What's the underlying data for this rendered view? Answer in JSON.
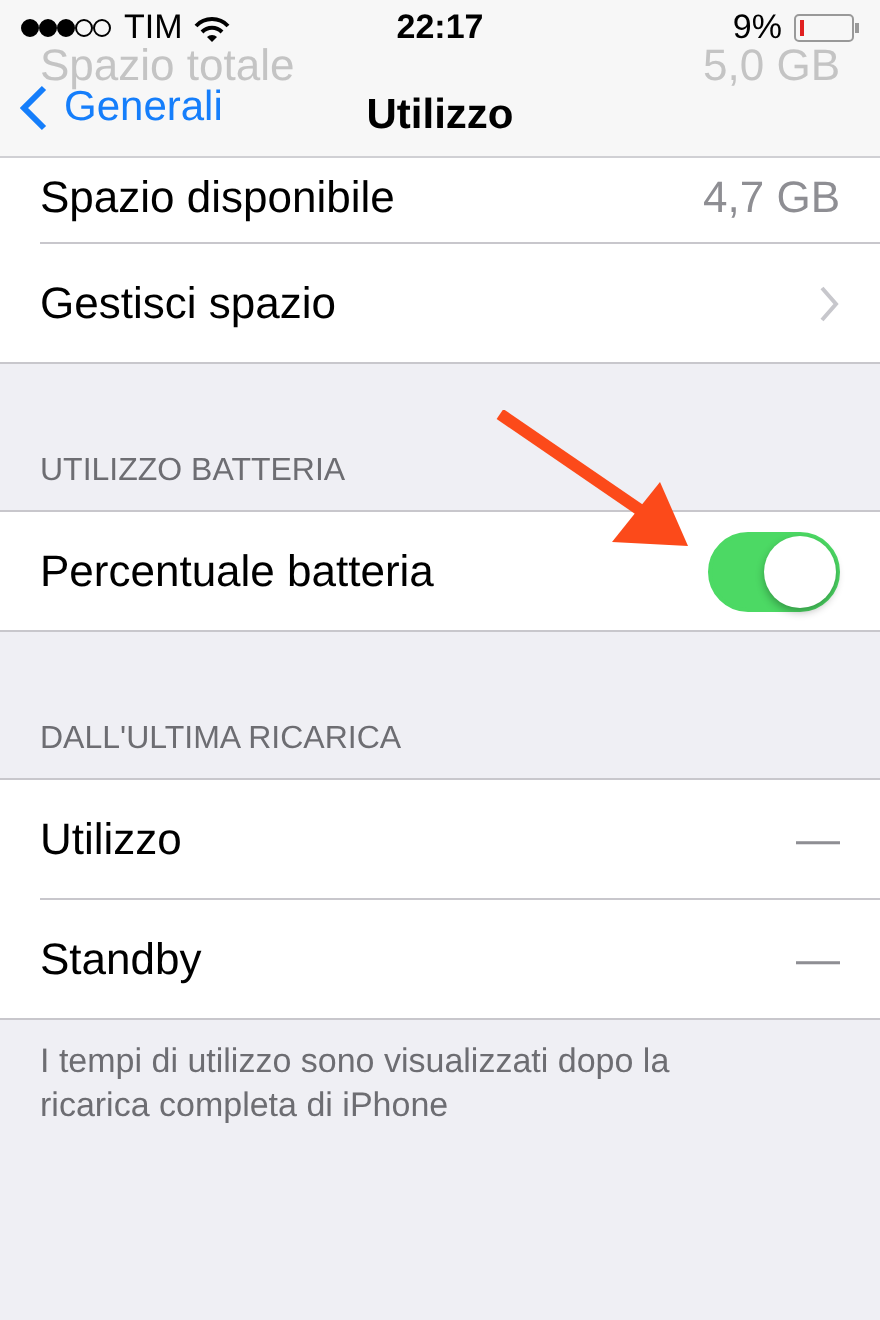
{
  "status_bar": {
    "carrier": "TIM",
    "time": "22:17",
    "battery": "9%"
  },
  "nav_bar": {
    "back": "Generali",
    "title": "Utilizzo"
  },
  "behind_nav": {
    "label": "Spazio totale",
    "value": "5,0 GB"
  },
  "sections": [
    {
      "rows": [
        {
          "kind": "value",
          "label": "Spazio disponibile",
          "value": "4,7 GB"
        },
        {
          "kind": "link",
          "label": "Gestisci spazio"
        }
      ]
    },
    {
      "header": "UTILIZZO BATTERIA",
      "rows": [
        {
          "kind": "toggle",
          "label": "Percentuale batteria",
          "on": true
        }
      ]
    },
    {
      "header": "DALL'ULTIMA RICARICA",
      "rows": [
        {
          "kind": "value",
          "label": "Utilizzo",
          "value": "—"
        },
        {
          "kind": "value",
          "label": "Standby",
          "value": "—"
        }
      ],
      "footer": "I tempi di utilizzo sono visualizzati dopo la ricarica completa di iPhone"
    }
  ]
}
